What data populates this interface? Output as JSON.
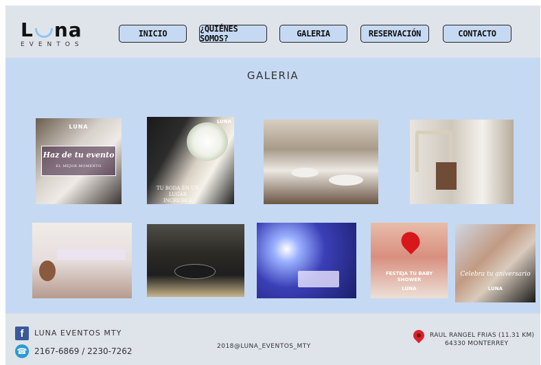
{
  "brand": {
    "logo_pre": "L",
    "logo_post": "na",
    "logo_sub": "EVENTOS"
  },
  "nav": [
    {
      "label": "INICIO"
    },
    {
      "label": "¿QUIÉNES SOMOS?"
    },
    {
      "label": "GALERIA"
    },
    {
      "label": "RESERVACIÓN"
    },
    {
      "label": "CONTACTO"
    }
  ],
  "gallery": {
    "title": "GALERIA",
    "photos": [
      {
        "name": "photo-haz-de-tu-evento",
        "caption": "Haz de tu evento",
        "sub": "EL MEJOR MOMENTO",
        "logo": "LUNA"
      },
      {
        "name": "photo-tu-boda",
        "caption": "TU BODA EN UN LUGAR INCREÍBLE",
        "logo": "LUNA"
      },
      {
        "name": "photo-salon-mesas"
      },
      {
        "name": "photo-salon-arco-floral"
      },
      {
        "name": "photo-mesa-infantil"
      },
      {
        "name": "photo-mesas-negras"
      },
      {
        "name": "photo-arboles-luces"
      },
      {
        "name": "photo-baby-shower",
        "caption": "FESTEJA TU BABY SHOWER",
        "logo": "LUNA"
      },
      {
        "name": "photo-aniversario",
        "caption": "Celebra tu aniversario",
        "logo": "LUNA"
      }
    ]
  },
  "footer": {
    "facebook": "LUNA EVENTOS MTY",
    "phones": "2167-6869 / 2230-7262",
    "instagram": "2018@LUNA_EVENTOS_MTY",
    "address_line1": "RAUL RANGEL FRIAS (11.31 KM)",
    "address_line2": "64330 MONTERREY"
  },
  "colors": {
    "header_bg": "#dfe3ea",
    "main_bg": "#c6d9f2",
    "button_bg": "#c6d9f2",
    "logo_accent": "#8fc6ee"
  }
}
